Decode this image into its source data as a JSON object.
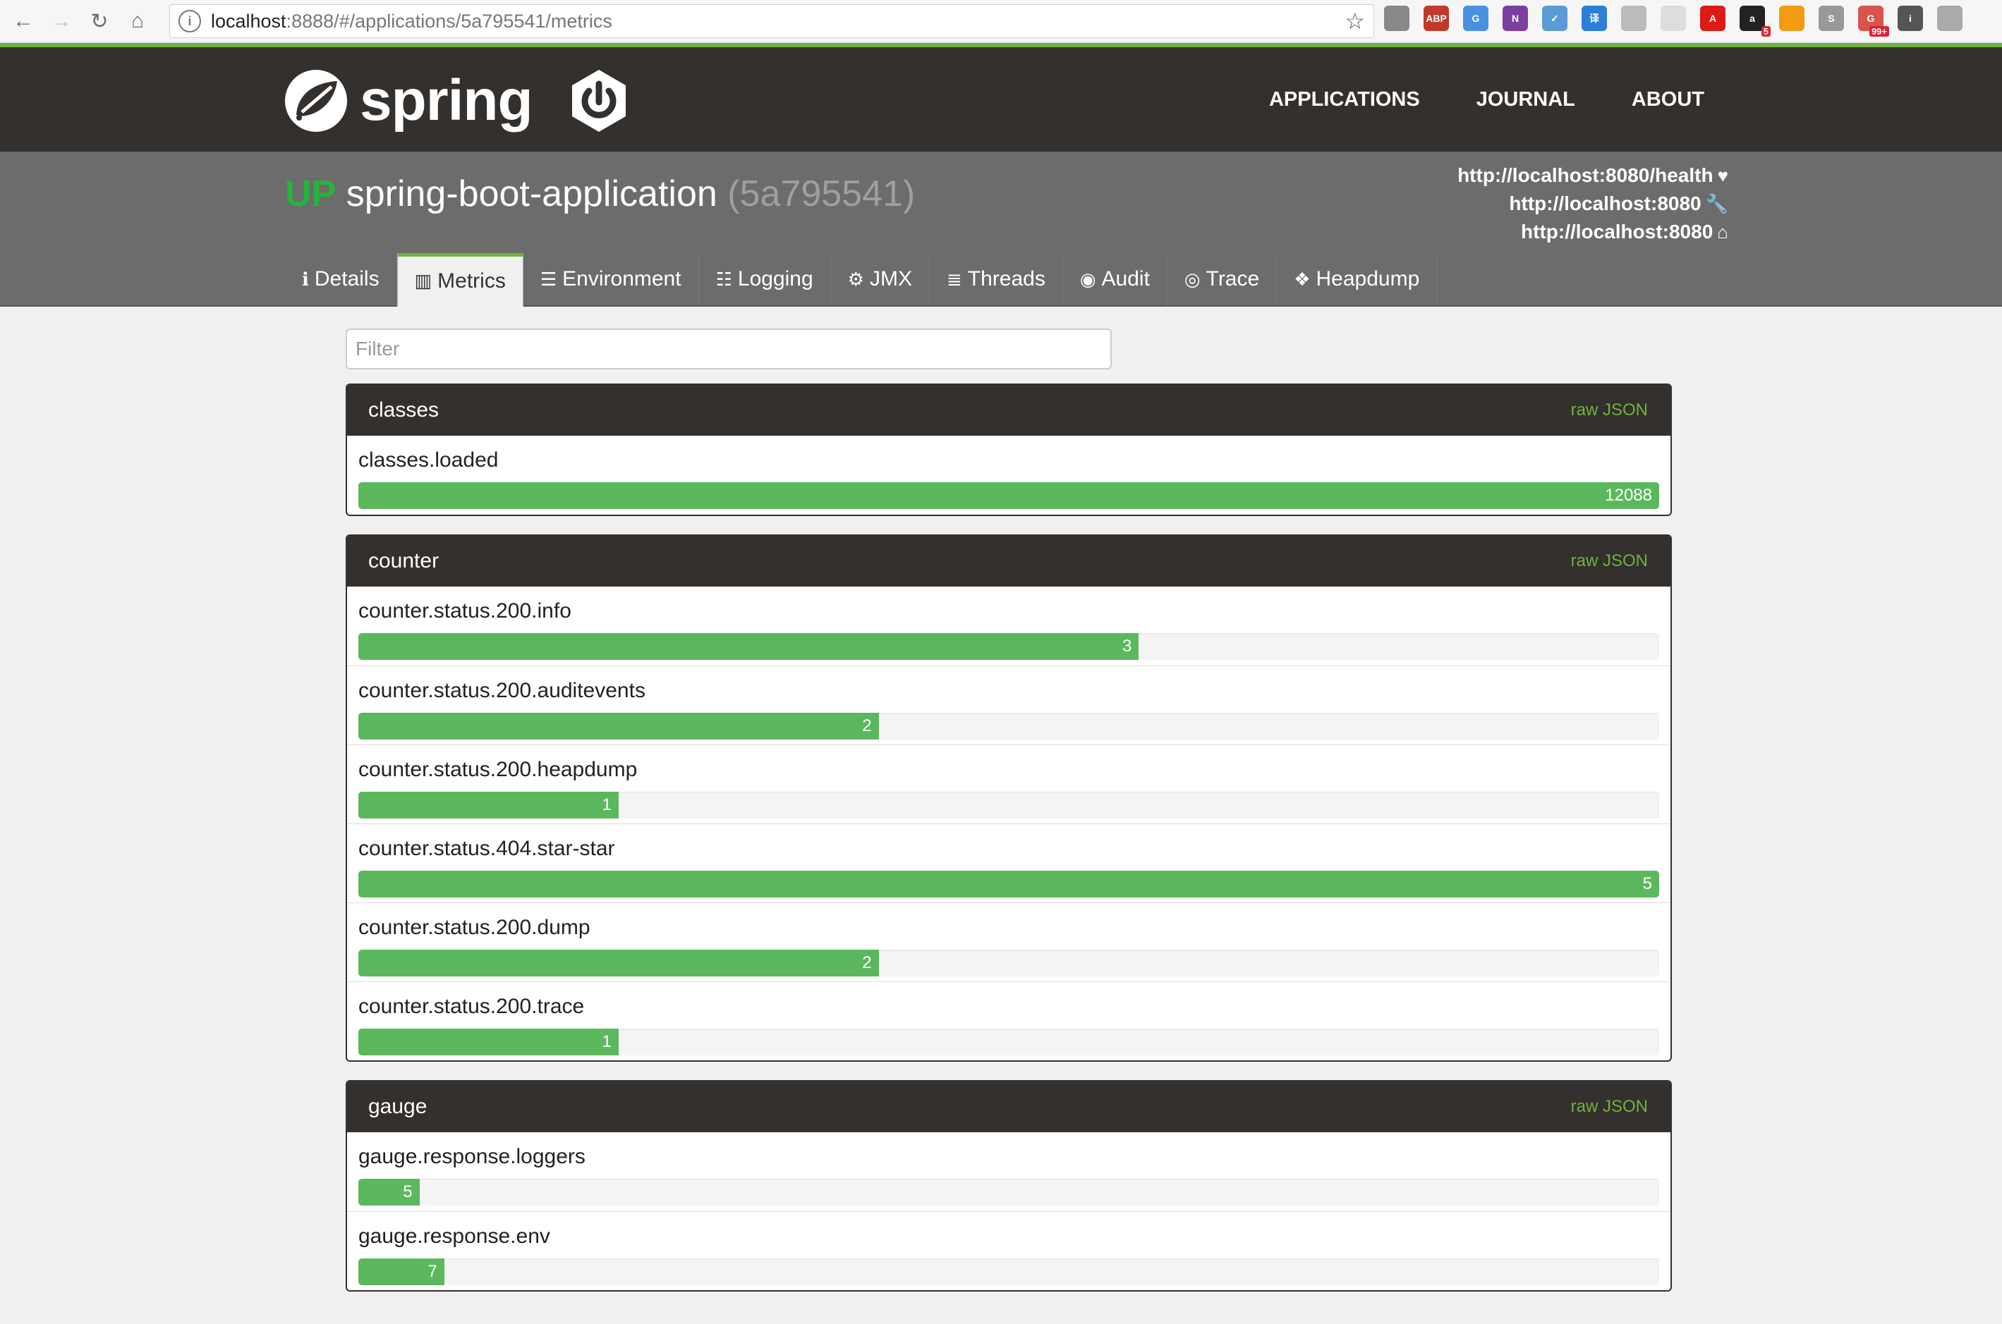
{
  "browser": {
    "url_host": "localhost",
    "url_path": ":8888/#/applications/5a795541/metrics"
  },
  "extensions": [
    {
      "icon": "recycle-icon",
      "label": "",
      "color": "#888888"
    },
    {
      "icon": "adblock-icon",
      "label": "ABP",
      "color": "#c0392b"
    },
    {
      "icon": "translate-icon",
      "label": "G",
      "color": "#4a90e2"
    },
    {
      "icon": "onenote-icon",
      "label": "N",
      "color": "#7b3fa0"
    },
    {
      "icon": "pen-icon",
      "label": "✓",
      "color": "#5b9bd5"
    },
    {
      "icon": "dictionary-icon",
      "label": "译",
      "color": "#2b7fd8"
    },
    {
      "icon": "reader-icon",
      "label": "",
      "color": "#bbbbbb"
    },
    {
      "icon": "swirl-icon",
      "label": "",
      "color": "#dddddd"
    },
    {
      "icon": "angular-icon",
      "label": "A",
      "color": "#dd1b16"
    },
    {
      "icon": "amazon-icon",
      "label": "a",
      "color": "#222222",
      "badge": "5"
    },
    {
      "icon": "cloud-icon",
      "label": "",
      "color": "#f39c12"
    },
    {
      "icon": "s-icon",
      "label": "S",
      "color": "#999999"
    },
    {
      "icon": "mail-icon",
      "label": "G",
      "color": "#d9534f",
      "badge": "99+"
    },
    {
      "icon": "info-circle-icon",
      "label": "i",
      "color": "#555555"
    },
    {
      "icon": "plane-icon",
      "label": "",
      "color": "#aaaaaa"
    }
  ],
  "header": {
    "logo_text": "spring",
    "nav": [
      "APPLICATIONS",
      "JOURNAL",
      "ABOUT"
    ]
  },
  "app": {
    "status": "UP",
    "name": "spring-boot-application",
    "id": "(5a795541)",
    "links": [
      {
        "url": "http://localhost:8080/health",
        "icon": "heartbeat-icon",
        "glyph": "♥"
      },
      {
        "url": "http://localhost:8080",
        "icon": "wrench-icon",
        "glyph": "🔧"
      },
      {
        "url": "http://localhost:8080",
        "icon": "home-icon",
        "glyph": "⌂"
      }
    ]
  },
  "tabs": [
    {
      "label": "Details",
      "icon": "info-icon",
      "glyph": "ℹ",
      "active": false
    },
    {
      "label": "Metrics",
      "icon": "bar-chart-icon",
      "glyph": "▥",
      "active": true
    },
    {
      "label": "Environment",
      "icon": "list-icon",
      "glyph": "☰",
      "active": false
    },
    {
      "label": "Logging",
      "icon": "sliders-icon",
      "glyph": "☷",
      "active": false
    },
    {
      "label": "JMX",
      "icon": "cogs-icon",
      "glyph": "⚙",
      "active": false
    },
    {
      "label": "Threads",
      "icon": "list-lines-icon",
      "glyph": "≣",
      "active": false
    },
    {
      "label": "Audit",
      "icon": "user-circle-icon",
      "glyph": "◉",
      "active": false
    },
    {
      "label": "Trace",
      "icon": "eye-icon",
      "glyph": "◎",
      "active": false
    },
    {
      "label": "Heapdump",
      "icon": "cubes-icon",
      "glyph": "❖",
      "active": false
    }
  ],
  "filter": {
    "placeholder": "Filter"
  },
  "raw_json_label": "raw JSON",
  "panels": [
    {
      "title": "classes",
      "metrics": [
        {
          "name": "classes.loaded",
          "value": 12088,
          "fraction": 1.0
        }
      ]
    },
    {
      "title": "counter",
      "metrics": [
        {
          "name": "counter.status.200.info",
          "value": 3,
          "fraction": 0.6
        },
        {
          "name": "counter.status.200.auditevents",
          "value": 2,
          "fraction": 0.4
        },
        {
          "name": "counter.status.200.heapdump",
          "value": 1,
          "fraction": 0.2
        },
        {
          "name": "counter.status.404.star-star",
          "value": 5,
          "fraction": 1.0
        },
        {
          "name": "counter.status.200.dump",
          "value": 2,
          "fraction": 0.4
        },
        {
          "name": "counter.status.200.trace",
          "value": 1,
          "fraction": 0.2
        }
      ]
    },
    {
      "title": "gauge",
      "metrics": [
        {
          "name": "gauge.response.loggers",
          "value": 5,
          "fraction": 0.047
        },
        {
          "name": "gauge.response.env",
          "value": 7,
          "fraction": 0.066
        }
      ]
    }
  ]
}
